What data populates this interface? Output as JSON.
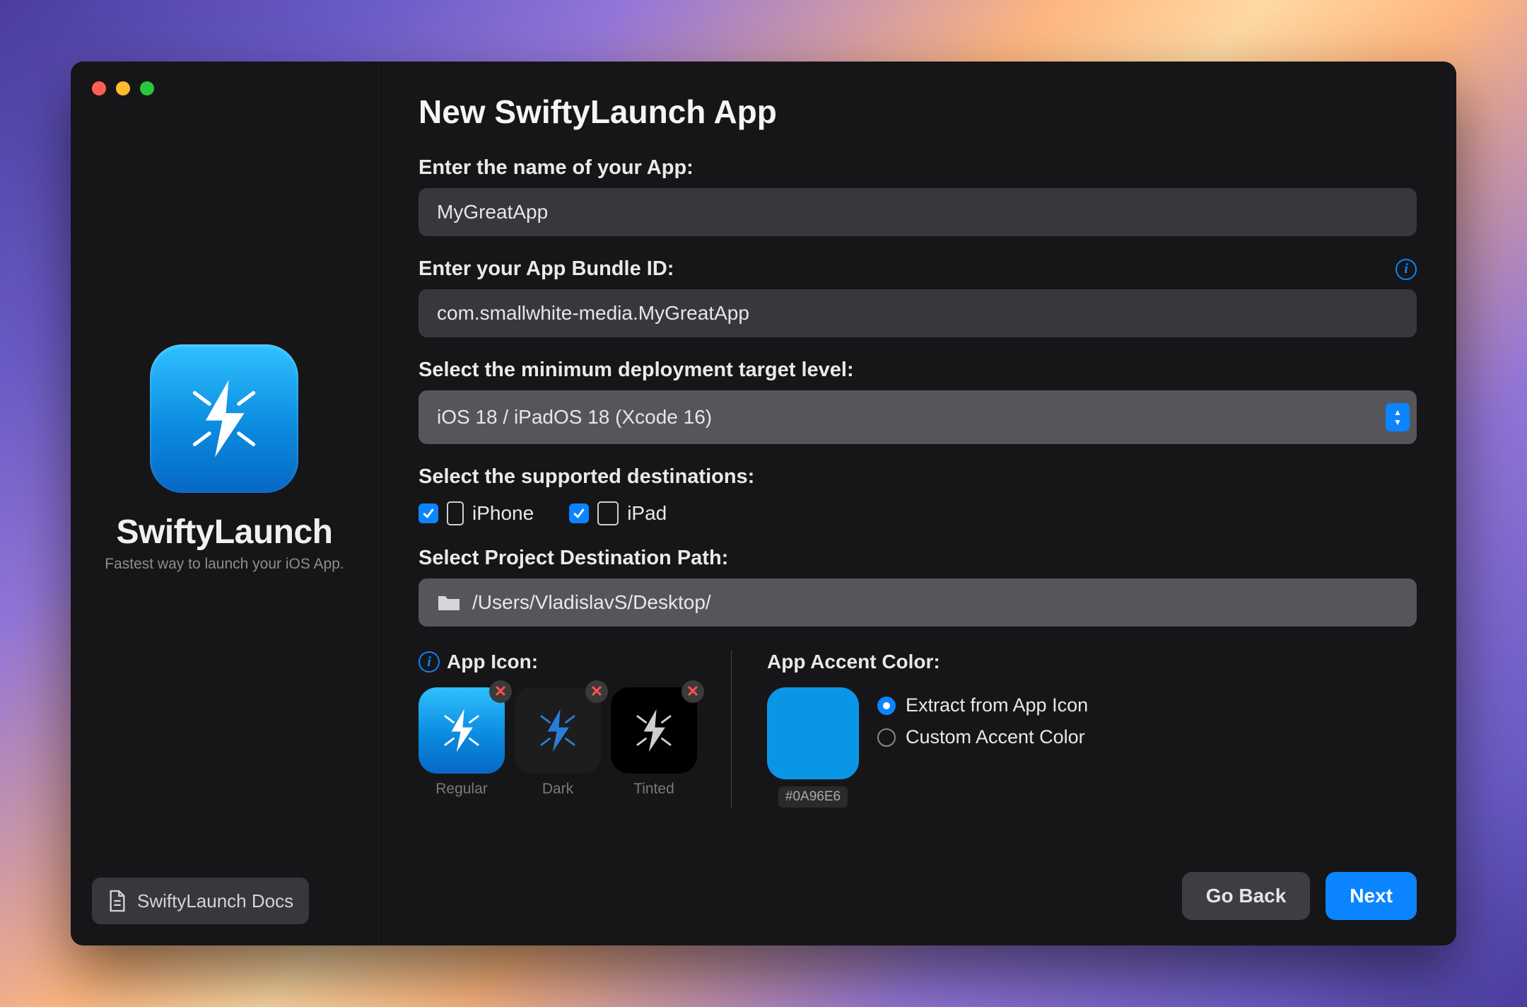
{
  "sidebar": {
    "app_name": "SwiftyLaunch",
    "tagline": "Fastest way to launch your iOS App.",
    "docs_button_label": "SwiftyLaunch Docs"
  },
  "page": {
    "title": "New SwiftyLaunch App",
    "labels": {
      "app_name": "Enter the name of your App:",
      "bundle_id": "Enter your App Bundle ID:",
      "deployment": "Select the minimum deployment target level:",
      "destinations": "Select the supported destinations:",
      "path": "Select Project Destination Path:",
      "app_icon": "App Icon:",
      "accent": "App Accent Color:"
    },
    "fields": {
      "app_name_value": "MyGreatApp",
      "bundle_id_value": "com.smallwhite-media.MyGreatApp",
      "deployment_value": "iOS 18 / iPadOS 18 (Xcode 16)",
      "path_value": "/Users/VladislavS/Desktop/"
    },
    "destinations": {
      "iphone": {
        "label": "iPhone",
        "checked": true
      },
      "ipad": {
        "label": "iPad",
        "checked": true
      }
    },
    "icons": {
      "regular": "Regular",
      "dark": "Dark",
      "tinted": "Tinted"
    },
    "accent": {
      "hex": "#0A96E6",
      "options": {
        "extract": "Extract from App Icon",
        "custom": "Custom Accent Color"
      },
      "selected": "extract"
    },
    "buttons": {
      "back": "Go Back",
      "next": "Next"
    }
  }
}
